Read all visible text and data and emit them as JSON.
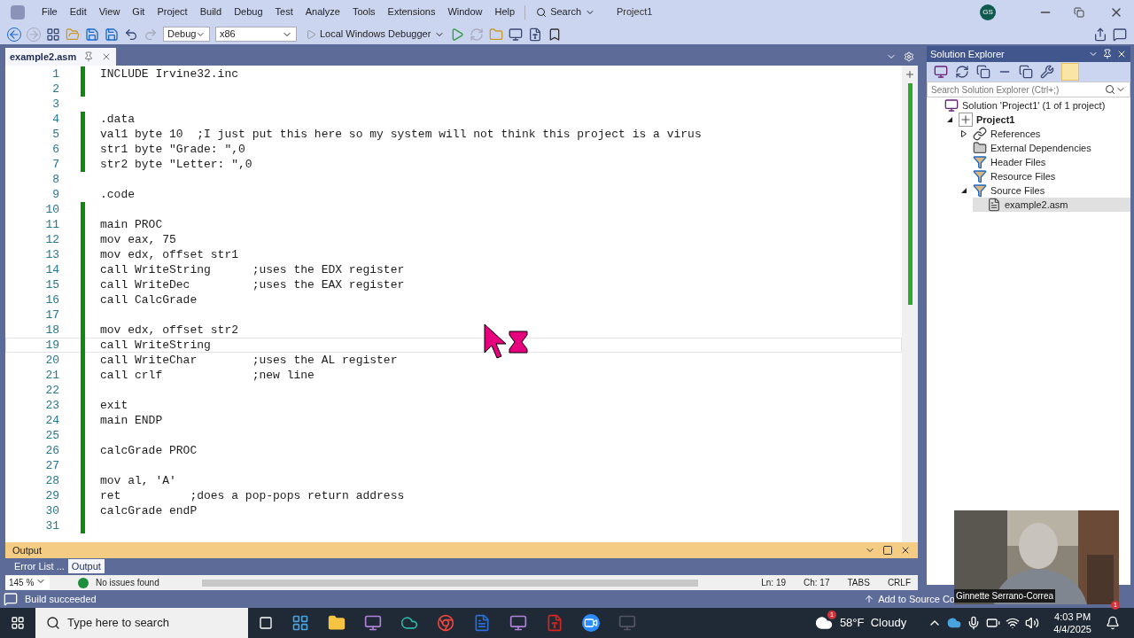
{
  "menu": [
    "File",
    "Edit",
    "View",
    "Git",
    "Project",
    "Build",
    "Debug",
    "Test",
    "Analyze",
    "Tools",
    "Extensions",
    "Window",
    "Help"
  ],
  "search_label": "Search",
  "title": "Project1",
  "user_initials": "GS",
  "toolbar": {
    "configuration": "Debug",
    "platform": "x86",
    "debugger": "Local Windows Debugger"
  },
  "tab": {
    "label": "example2.asm",
    "selected": true
  },
  "code_lines": [
    {
      "number": "1",
      "text": "INCLUDE Irvine32.inc",
      "changed": true,
      "current": false
    },
    {
      "number": "2",
      "changed": true,
      "current": false
    },
    {
      "number": "3",
      "changed": false,
      "current": false
    },
    {
      "number": "4",
      "text": ".data",
      "changed": true,
      "current": false
    },
    {
      "number": "5",
      "text": "val1 byte 10  ;I just put this here so my system will not think this project is a virus",
      "changed": true,
      "current": false
    },
    {
      "number": "6",
      "text": "str1 byte \"Grade: \",0",
      "changed": true,
      "current": false
    },
    {
      "number": "7",
      "text": "str2 byte \"Letter: \",0",
      "changed": true,
      "current": false
    },
    {
      "number": "8",
      "changed": false,
      "current": false
    },
    {
      "number": "9",
      "text": ".code",
      "changed": false,
      "current": false
    },
    {
      "number": "10",
      "changed": true,
      "current": false
    },
    {
      "number": "11",
      "text": "main PROC",
      "changed": true,
      "current": false
    },
    {
      "number": "12",
      "text": "mov eax, 75",
      "changed": true,
      "current": false
    },
    {
      "number": "13",
      "text": "mov edx, offset str1",
      "changed": true,
      "current": false
    },
    {
      "number": "14",
      "text": "call WriteString      ;uses the EDX register",
      "changed": true,
      "current": false
    },
    {
      "number": "15",
      "text": "call WriteDec         ;uses the EAX register",
      "changed": true,
      "current": false
    },
    {
      "number": "16",
      "text": "call CalcGrade",
      "changed": true,
      "current": false
    },
    {
      "number": "17",
      "changed": true,
      "current": false
    },
    {
      "number": "18",
      "text": "mov edx, offset str2",
      "changed": true,
      "current": false
    },
    {
      "number": "19",
      "text": "call WriteString",
      "changed": true,
      "current": true
    },
    {
      "number": "20",
      "text": "call WriteChar        ;uses the AL register",
      "changed": true,
      "current": false
    },
    {
      "number": "21",
      "text": "call crlf             ;new line",
      "changed": true,
      "current": false
    },
    {
      "number": "22",
      "changed": true,
      "current": false
    },
    {
      "number": "23",
      "text": "exit",
      "changed": true,
      "current": false
    },
    {
      "number": "24",
      "text": "main ENDP",
      "changed": true,
      "current": false
    },
    {
      "number": "25",
      "changed": true,
      "current": false
    },
    {
      "number": "26",
      "text": "calcGrade PROC",
      "changed": true,
      "current": false
    },
    {
      "number": "27",
      "changed": true,
      "current": false
    },
    {
      "number": "28",
      "text": "mov al, 'A'",
      "changed": true,
      "current": false
    },
    {
      "number": "29",
      "text": "ret          ;does a pop-pops return address",
      "changed": true,
      "current": false
    },
    {
      "number": "30",
      "text": "calcGrade endP",
      "changed": true,
      "current": false
    },
    {
      "number": "31",
      "changed": true,
      "current": false
    }
  ],
  "solution_explorer": {
    "title": "Solution Explorer",
    "search_placeholder": "Search Solution Explorer (Ctrl+;)",
    "tree": [
      {
        "label": "Solution 'Project1' (1 of 1 project)",
        "kind": "solution",
        "selected": false,
        "children": [
          {
            "label": "Project1",
            "kind": "project",
            "expanded": true,
            "selected": false,
            "children": [
              {
                "label": "References",
                "kind": "references",
                "expanded": false,
                "selected": false
              },
              {
                "label": "External Dependencies",
                "kind": "external",
                "selected": false
              },
              {
                "label": "Header Files",
                "kind": "filter",
                "selected": false
              },
              {
                "label": "Resource Files",
                "kind": "filter",
                "selected": false
              },
              {
                "label": "Source Files",
                "kind": "filter",
                "expanded": true,
                "selected": false,
                "children": [
                  {
                    "label": "example2.asm",
                    "kind": "file",
                    "selected": true
                  }
                ]
              }
            ]
          }
        ]
      }
    ]
  },
  "output_panel": {
    "title": "Output",
    "tabs": [
      {
        "label": "Error List ...",
        "selected": false
      },
      {
        "label": "Output",
        "selected": true
      }
    ]
  },
  "editor_status": {
    "zoom": "145 %",
    "issues": "No issues found",
    "line": "Ln: 19",
    "column": "Ch: 17",
    "indent": "TABS",
    "line_ending": "CRLF"
  },
  "status_bar": {
    "message": "Build succeeded",
    "source_control": "Add to Source Co"
  },
  "video": {
    "kind": "picture",
    "caption": "Ginnette Serrano-Correa"
  },
  "taskbar": {
    "search_placeholder": "Type here to search",
    "weather": "58°F  Cloudy",
    "weather_badge": "1",
    "time": "4:03 PM",
    "date": "4/4/2025",
    "video_badge": "1"
  }
}
